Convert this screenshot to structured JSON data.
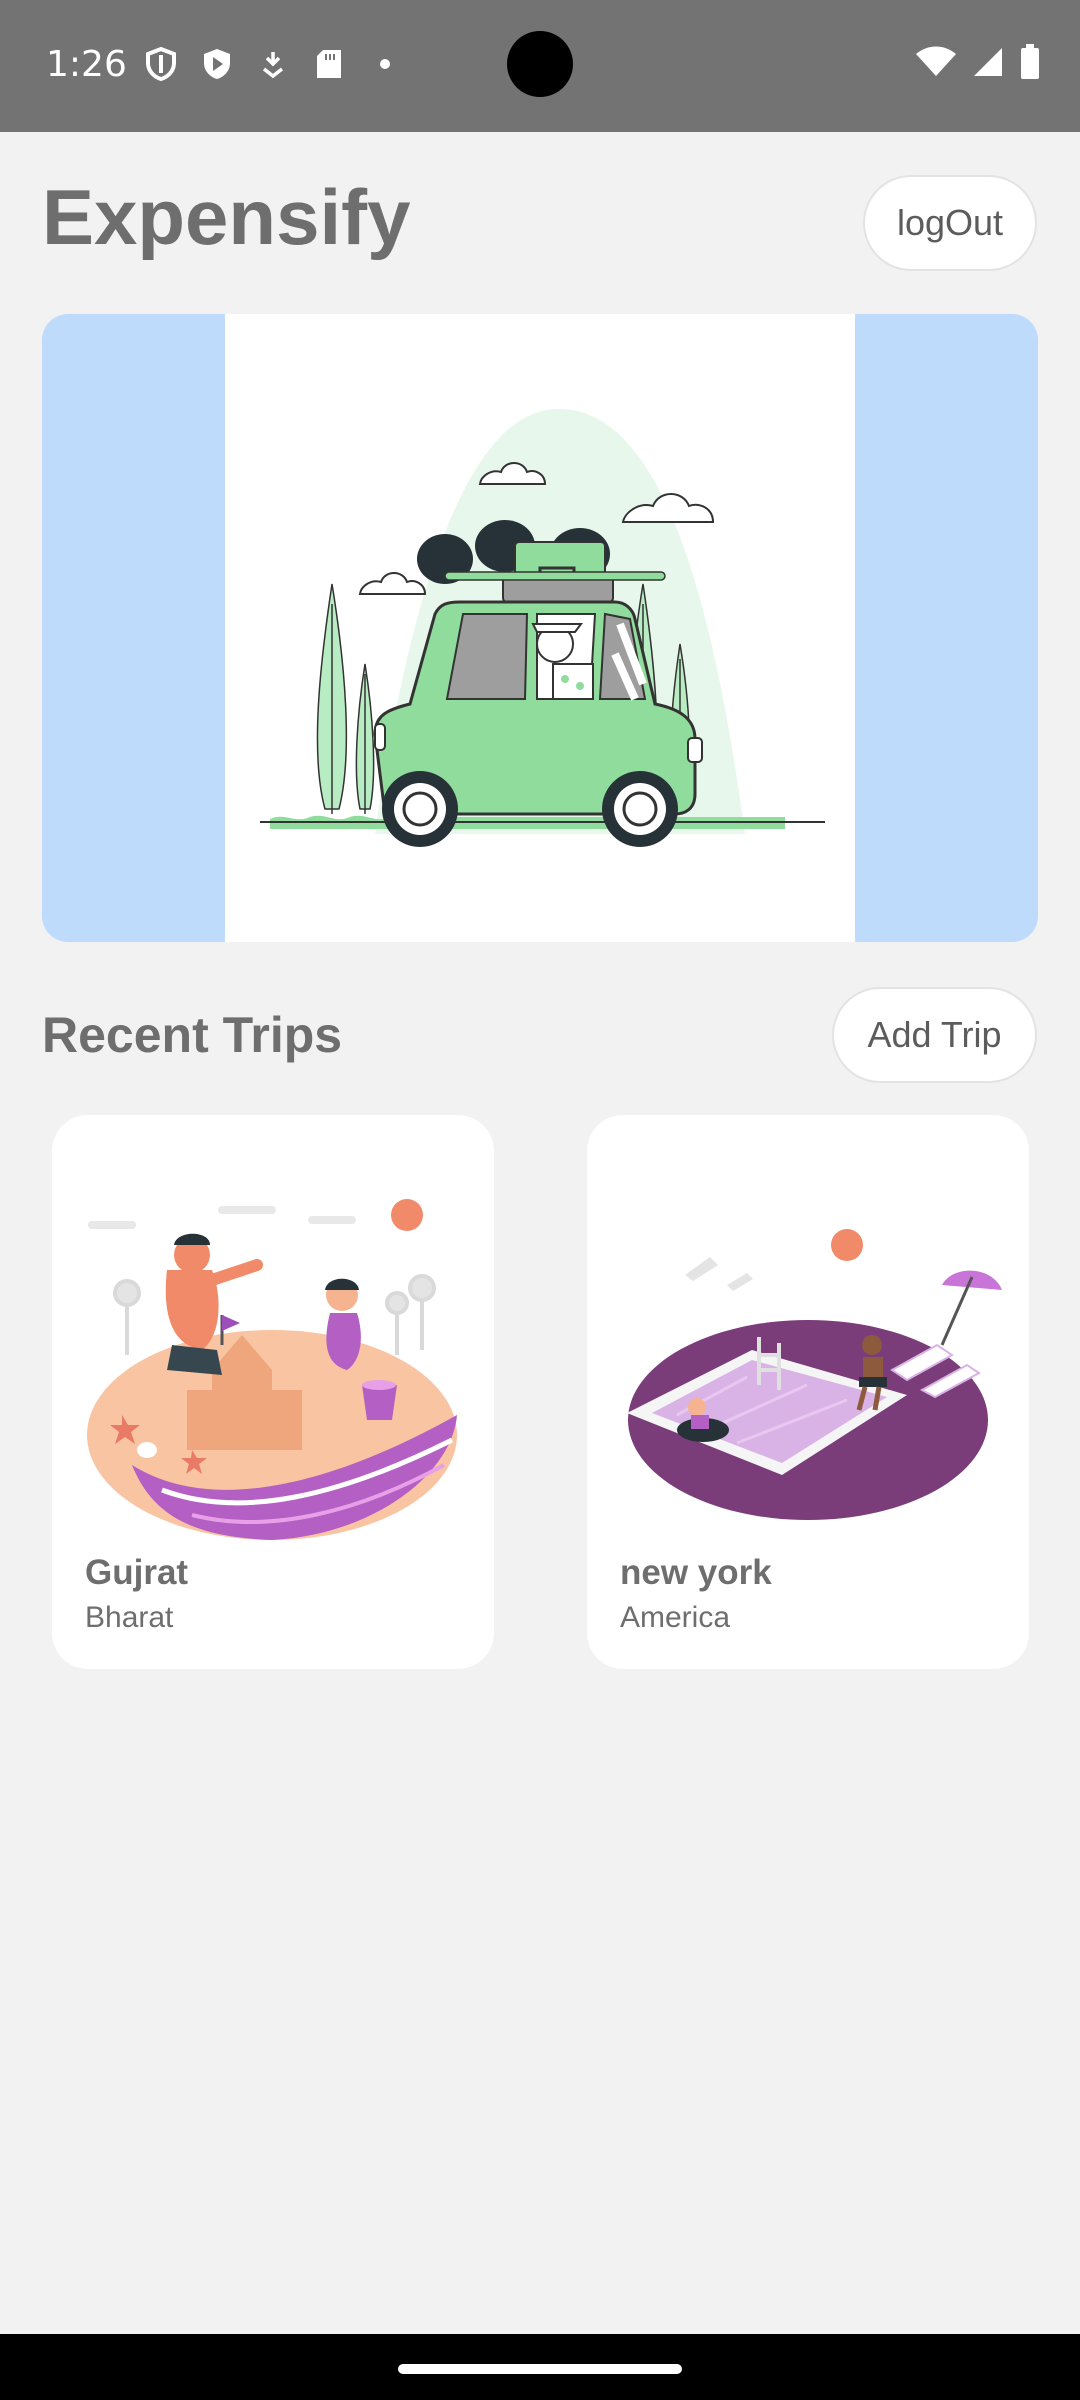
{
  "status_bar": {
    "time": "1:26",
    "left_icons": [
      "shield-icon",
      "play-icon",
      "download-icon",
      "sd-card-icon",
      "dot-icon"
    ],
    "right_icons": [
      "wifi-icon",
      "signal-icon",
      "battery-icon"
    ]
  },
  "header": {
    "title": "Expensify",
    "logout_label": "logOut"
  },
  "banner": {
    "image": "car-trip-illustration"
  },
  "recent_trips": {
    "title": "Recent Trips",
    "add_label": "Add Trip",
    "trips": [
      {
        "name": "Gujrat",
        "country": "Bharat",
        "image": "beach-sandcastle-illustration"
      },
      {
        "name": "new york",
        "country": "America",
        "image": "pool-illustration"
      }
    ]
  },
  "colors": {
    "status_bar": "#737373",
    "background": "#f2f2f2",
    "banner_bg": "#bfdbfb",
    "text": "#6e6e6e",
    "accent_green": "#8fdc9c",
    "accent_purple": "#7a3d7a"
  }
}
